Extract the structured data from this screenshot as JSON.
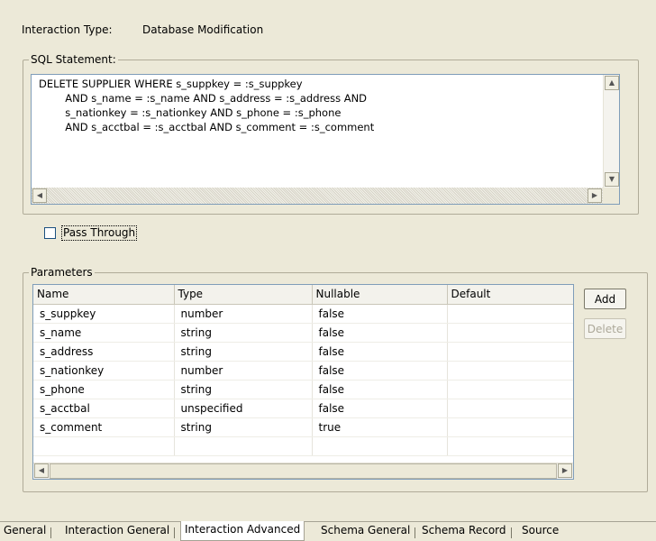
{
  "interaction_type": {
    "label": "Interaction Type:",
    "value": "Database Modification"
  },
  "sql_group": {
    "title": "SQL Statement:",
    "statement": "DELETE SUPPLIER WHERE s_suppkey = :s_suppkey\n        AND s_name = :s_name AND s_address = :s_address AND\n        s_nationkey = :s_nationkey AND s_phone = :s_phone\n        AND s_acctbal = :s_acctbal AND s_comment = :s_comment"
  },
  "pass_through": {
    "label": "Pass Through",
    "checked": false
  },
  "parameters": {
    "title": "Parameters",
    "columns": [
      "Name",
      "Type",
      "Nullable",
      "Default"
    ],
    "rows": [
      [
        "s_suppkey",
        "number",
        "false",
        ""
      ],
      [
        "s_name",
        "string",
        "false",
        ""
      ],
      [
        "s_address",
        "string",
        "false",
        ""
      ],
      [
        "s_nationkey",
        "number",
        "false",
        ""
      ],
      [
        "s_phone",
        "string",
        "false",
        ""
      ],
      [
        "s_acctbal",
        "unspecified",
        "false",
        ""
      ],
      [
        "s_comment",
        "string",
        "true",
        ""
      ]
    ],
    "add_label": "Add",
    "delete_label": "Delete"
  },
  "tabs": [
    {
      "label": "General",
      "active": false
    },
    {
      "label": "Interaction General",
      "active": false
    },
    {
      "label": "Interaction Advanced",
      "active": true
    },
    {
      "label": "Schema General",
      "active": false
    },
    {
      "label": "Schema Record",
      "active": false
    },
    {
      "label": "Source",
      "active": false
    }
  ]
}
